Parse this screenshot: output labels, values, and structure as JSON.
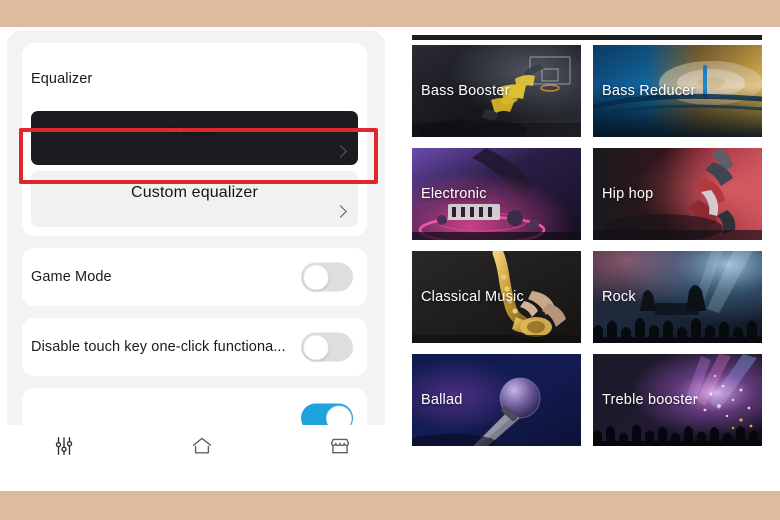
{
  "theme": {
    "band_color": "#ddbb9d",
    "panel_bg": "#f3f3f4",
    "card_bg": "#ffffff",
    "subbutton_bg": "#f1f1f2",
    "highlight_color": "#e0262f",
    "toggle_on_color": "#1ea2e0",
    "toggle_off_color": "#dddee0",
    "text_color": "#1b1b1b",
    "preset_text_color": "#ffffff"
  },
  "settings_panel": {
    "card_title": "Equalizer",
    "sub_buttons": [
      {
        "label": "Preset",
        "chevron": "chevron-right-icon",
        "highlighted": true
      },
      {
        "label": "Custom equalizer",
        "chevron": "chevron-right-icon",
        "highlighted": false
      }
    ],
    "toggle_rows": [
      {
        "label": "Game Mode",
        "state": "off"
      },
      {
        "label": "Disable touch key one-click functiona...",
        "state": "off"
      },
      {
        "label": "",
        "state": "on"
      }
    ],
    "bottom_nav": [
      {
        "icon": "equalizer-sliders-icon",
        "label": ""
      },
      {
        "icon": "home-icon",
        "label": ""
      },
      {
        "icon": "store-icon",
        "label": ""
      }
    ]
  },
  "preset_panel": {
    "presets": [
      {
        "name": "Bass Booster",
        "art": "basketball-dunk"
      },
      {
        "name": "Bass Reducer",
        "art": "turntable"
      },
      {
        "name": "Electronic",
        "art": "dj-deck"
      },
      {
        "name": "Hip hop",
        "art": "dancer-red"
      },
      {
        "name": "Classical Music",
        "art": "saxophone"
      },
      {
        "name": "Rock",
        "art": "concert-crowd"
      },
      {
        "name": "Ballad",
        "art": "microphone"
      },
      {
        "name": "Treble booster",
        "art": "festival-lights"
      }
    ]
  }
}
